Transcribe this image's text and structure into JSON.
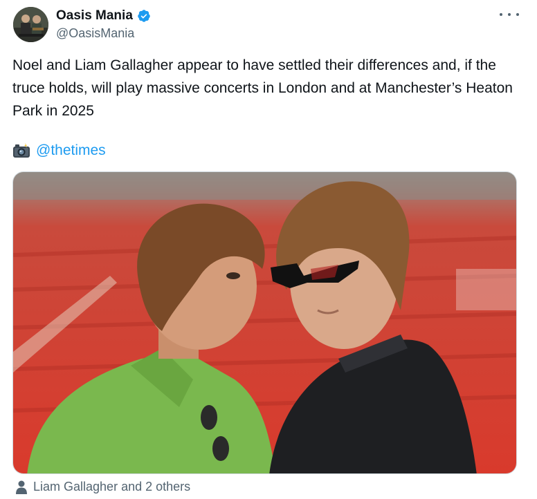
{
  "author": {
    "display_name": "Oasis Mania",
    "handle": "@OasisMania",
    "verified": true,
    "avatar_icon": "band-photo-avatar"
  },
  "tweet": {
    "text": "Noel and Liam Gallagher appear to have settled their differences and, if the truce holds, will play massive concerts in London and at Manchester’s Heaton Park in 2025",
    "credit_emoji_icon": "camera-flash-icon",
    "credit_mention": "@thetimes"
  },
  "media": {
    "photo_icon": "photo-two-men-stadium"
  },
  "tagged": {
    "icon": "person-icon",
    "label": "Liam Gallagher and 2 others"
  },
  "colors": {
    "link": "#1d9bf0",
    "secondary_text": "#536471",
    "verified": "#1d9bf0",
    "stadium_red": "#d63a2f"
  }
}
